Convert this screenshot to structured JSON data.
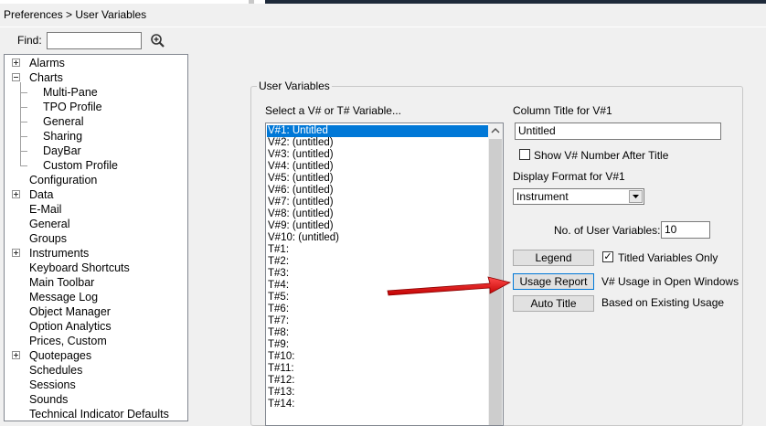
{
  "window": {
    "title": "Preferences > User Variables"
  },
  "find": {
    "label": "Find:",
    "value": ""
  },
  "tree": {
    "items": [
      {
        "label": "Alarms",
        "expander": "plus"
      },
      {
        "label": "Charts",
        "expander": "minus"
      },
      {
        "label": "Multi-Pane",
        "child": true
      },
      {
        "label": "TPO Profile",
        "child": true
      },
      {
        "label": "General",
        "child": true
      },
      {
        "label": "Sharing",
        "child": true
      },
      {
        "label": "DayBar",
        "child": true
      },
      {
        "label": "Custom Profile",
        "child": true
      },
      {
        "label": "Configuration"
      },
      {
        "label": "Data",
        "expander": "plus"
      },
      {
        "label": "E-Mail"
      },
      {
        "label": "General"
      },
      {
        "label": "Groups"
      },
      {
        "label": "Instruments",
        "expander": "plus"
      },
      {
        "label": "Keyboard Shortcuts"
      },
      {
        "label": "Main Toolbar"
      },
      {
        "label": "Message Log"
      },
      {
        "label": "Object Manager"
      },
      {
        "label": "Option Analytics"
      },
      {
        "label": "Prices, Custom"
      },
      {
        "label": "Quotepages",
        "expander": "plus"
      },
      {
        "label": "Schedules"
      },
      {
        "label": "Sessions"
      },
      {
        "label": "Sounds"
      },
      {
        "label": "Technical Indicator Defaults"
      }
    ]
  },
  "panel": {
    "group_title": "User Variables",
    "select_label": "Select a V# or T# Variable...",
    "variables": [
      "V#1: Untitled",
      "V#2: (untitled)",
      "V#3: (untitled)",
      "V#4: (untitled)",
      "V#5: (untitled)",
      "V#6: (untitled)",
      "V#7: (untitled)",
      "V#8: (untitled)",
      "V#9: (untitled)",
      "V#10: (untitled)",
      "T#1:",
      "T#2:",
      "T#3:",
      "T#4:",
      "T#5:",
      "T#6:",
      "T#7:",
      "T#8:",
      "T#9:",
      "T#10:",
      "T#11:",
      "T#12:",
      "T#13:",
      "T#14:"
    ],
    "column_title_label": "Column Title for V#1",
    "column_title_value": "Untitled",
    "show_number_label": "Show V# Number After Title",
    "show_number_checked": false,
    "display_format_label": "Display Format for V#1",
    "display_format_value": "Instrument",
    "num_vars_label": "No. of User Variables:",
    "num_vars_value": "10",
    "legend_button": "Legend",
    "titled_only_label": "Titled Variables Only",
    "titled_only_checked": true,
    "usage_report_button": "Usage Report",
    "usage_report_desc": "V# Usage in Open Windows",
    "auto_title_button": "Auto Title",
    "auto_title_desc": "Based on Existing Usage"
  },
  "annotation": {
    "arrow_color": "#e02020"
  }
}
